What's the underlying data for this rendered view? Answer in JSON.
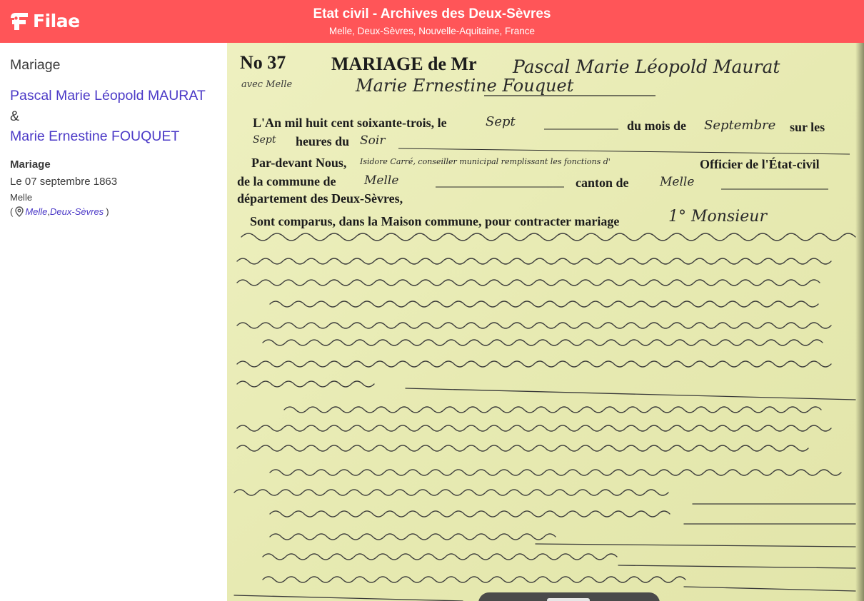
{
  "header": {
    "logo_text": "Filae",
    "title": "Etat civil - Archives des Deux-Sèvres",
    "subtitle": "Melle, Deux-Sèvres, Nouvelle-Aquitaine, France",
    "background_color": "#ff5558"
  },
  "sidebar": {
    "heading": "Mariage",
    "person_1": "Pascal Marie Léopold MAURAT",
    "ampersand": "&",
    "person_2": "Marie Ernestine FOUQUET",
    "event_type": "Mariage",
    "event_date": "Le 07 septembre 1863",
    "event_place": "Melle",
    "location_open": "(",
    "location_city": "Melle",
    "location_sep": ", ",
    "location_dept": "Deux-Sèvres",
    "location_close": ")",
    "location_icon": "map-pin-icon",
    "link_color": "#4b39c7"
  },
  "document": {
    "number_label": "No 37",
    "title_label": "MARIAGE de Mr",
    "groom_name_handwritten": "Pascal Marie Léopold Maurat",
    "bride_prefix": "avec Melle",
    "bride_name_handwritten": "Marie Ernestine Fouquet",
    "lines": [
      "L'An mil huit cent soixante-trois, le",
      "Sept",
      "du mois de",
      "Septembre",
      "sur les",
      "Sept",
      "heures du",
      "Soir",
      "Par-devant Nous,",
      "Isidore Carré, conseiller municipal remplissant les fonctions d'",
      "Officier de l'État-civil",
      "de la commune de",
      "Melle",
      "canton de",
      "Melle",
      "département des Deux-Sèvres,",
      "Sont comparus, dans la Maison commune, pour contracter mariage",
      "1° Monsieur"
    ],
    "paper_color": "#e8ebb6"
  }
}
